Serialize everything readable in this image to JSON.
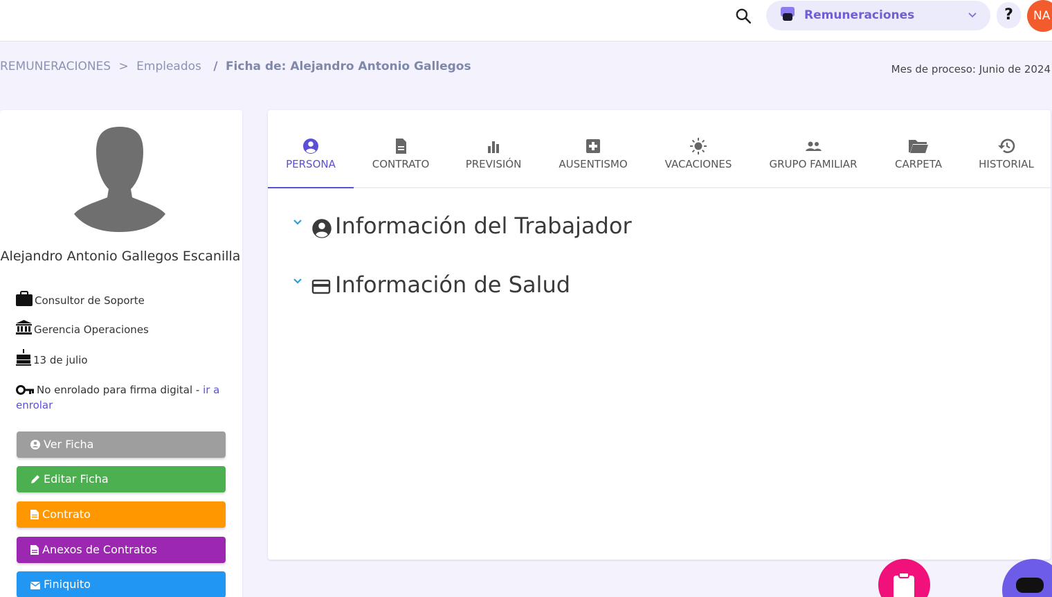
{
  "header": {
    "module_label": "Remuneraciones",
    "help_label": "?",
    "avatar_initials": "NA"
  },
  "breadcrumb": {
    "root": "REMUNERACIONES",
    "sep1": ">",
    "employees": "Empleados",
    "sep2": "/",
    "current": "Ficha de: Alejandro Antonio Gallegos"
  },
  "process_month": "Mes de proceso: Junio de 2024",
  "profile": {
    "name": "Alejandro Antonio Gallegos Escanilla",
    "job_title": "Consultor de Soporte",
    "department": "Gerencia Operaciones",
    "birthday": "13 de julio",
    "signature_status": "No enrolado para firma digital - ",
    "enroll_link": "ir a enrolar"
  },
  "actions": {
    "ver_ficha": "Ver Ficha",
    "editar_ficha": "Editar Ficha",
    "contrato": "Contrato",
    "anexos": "Anexos de Contratos",
    "finiquito": "Finiquito"
  },
  "tabs": [
    {
      "label": "PERSONA",
      "icon": "account-circle-icon",
      "active": true
    },
    {
      "label": "CONTRATO",
      "icon": "document-icon"
    },
    {
      "label": "PREVISIÓN",
      "icon": "bar-chart-icon"
    },
    {
      "label": "AUSENTISMO",
      "icon": "medical-plus-icon"
    },
    {
      "label": "VACACIONES",
      "icon": "sun-icon"
    },
    {
      "label": "GRUPO FAMILIAR",
      "icon": "people-icon"
    },
    {
      "label": "CARPETA",
      "icon": "folder-open-icon"
    },
    {
      "label": "HISTORIAL",
      "icon": "history-icon"
    }
  ],
  "sections": {
    "trabajador": "Información del Trabajador",
    "salud": "Información de Salud"
  },
  "colors": {
    "accent": "#5b4fd6",
    "btn_ver": "#9e9e9e",
    "btn_editar": "#4caf50",
    "btn_contrato": "#ff9800",
    "btn_anexos": "#9c27b0",
    "btn_finiquito": "#2196f3",
    "avatar_bg": "#f25c2c",
    "fab_pink": "#f0117a",
    "fab_purple": "#6c5ce7"
  }
}
